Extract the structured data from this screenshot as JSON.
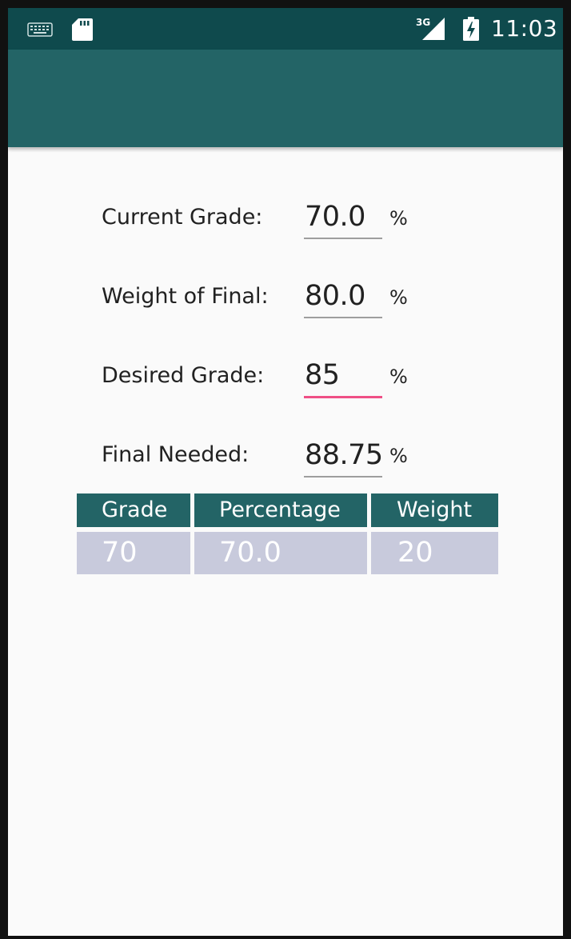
{
  "status_bar": {
    "network_type": "3G",
    "time": "11:03",
    "icons": [
      "keyboard-icon",
      "sd-card-icon",
      "signal-icon",
      "battery-charging-icon"
    ]
  },
  "form": {
    "current_grade": {
      "label": "Current Grade:",
      "value": "70.0",
      "unit": "%"
    },
    "weight_of_final": {
      "label": "Weight of Final:",
      "value": "80.0",
      "unit": "%"
    },
    "desired_grade": {
      "label": "Desired Grade:",
      "value": "85",
      "unit": "%"
    },
    "final_needed": {
      "label": "Final Needed:",
      "value": "88.75",
      "unit": "%"
    }
  },
  "table": {
    "headers": [
      "Grade",
      "Percentage",
      "Weight"
    ],
    "rows": [
      [
        "70",
        "70.0",
        "20"
      ]
    ]
  },
  "colors": {
    "status_bar": "#0f4a4d",
    "app_bar": "#236466",
    "table_header": "#236466",
    "table_cell": "#c8cadc",
    "focus_underline": "#ef4f86"
  }
}
